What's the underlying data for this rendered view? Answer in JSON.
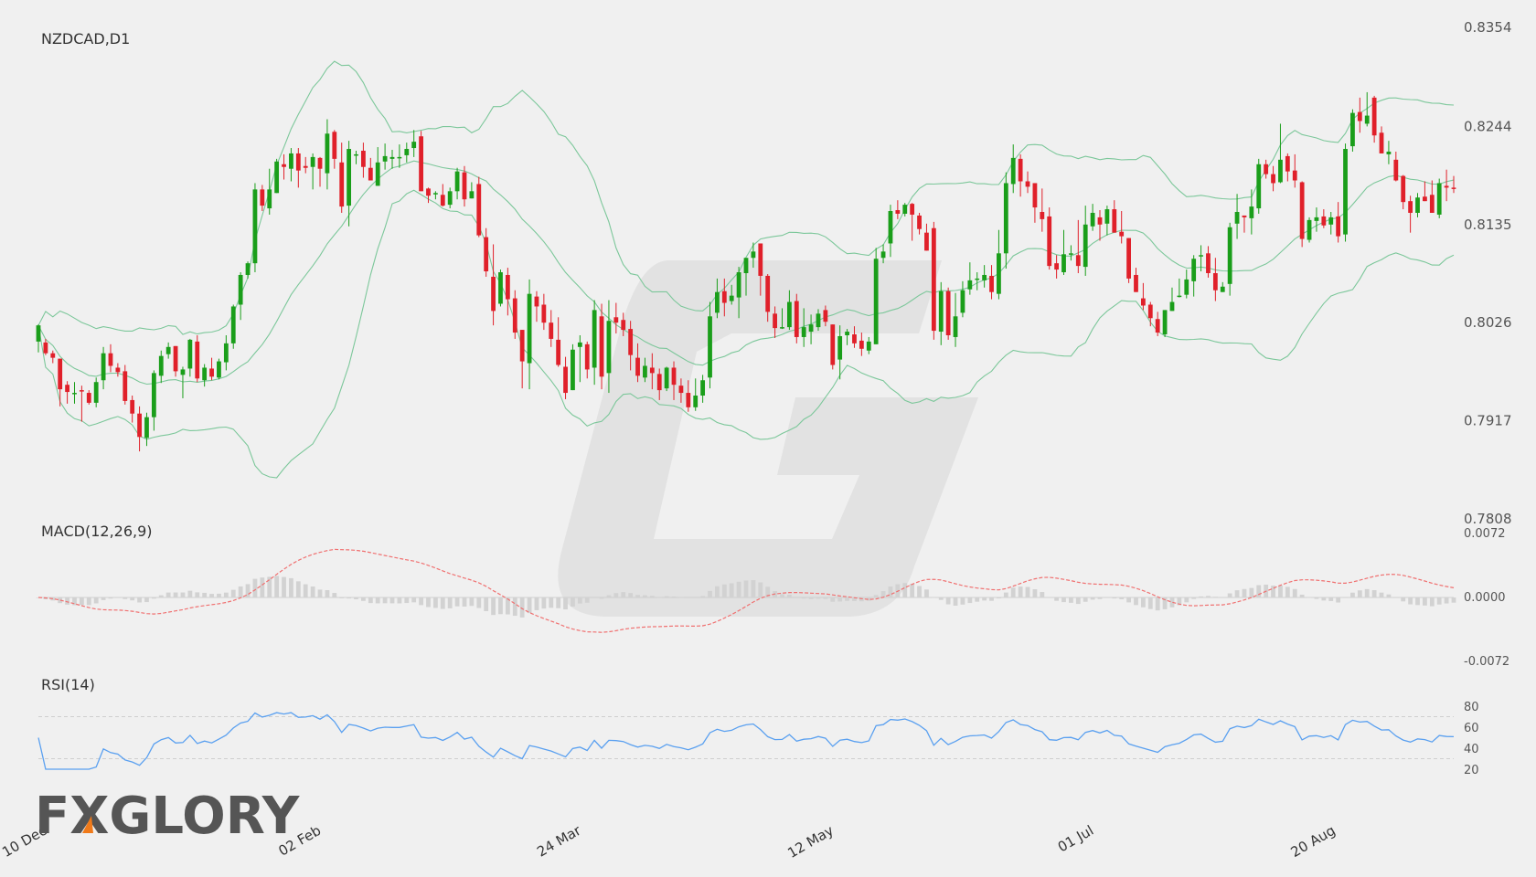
{
  "colors": {
    "background": "#f0f0f0",
    "bull": "#1a9e1a",
    "bear": "#e0202a",
    "bands": "#7cc79a",
    "macd_signal": "#f07070",
    "macd_hist": "#d2d2d2",
    "rsi": "#5aa0f0",
    "watermark": "#e2e2e2"
  },
  "logo": {
    "text": "FXGLORY"
  },
  "chart_data": {
    "type": "candlestick",
    "symbol_label": "NZDCAD,D1",
    "price_axis": {
      "ticks": [
        "0.8354",
        "0.8244",
        "0.8135",
        "0.8026",
        "0.7917",
        "0.7808"
      ],
      "ylim": [
        0.7808,
        0.8354
      ]
    },
    "x_ticks": [
      {
        "label": "10 Dec",
        "index": 0
      },
      {
        "label": "02 Feb",
        "index": 38
      },
      {
        "label": "24 Mar",
        "index": 74
      },
      {
        "label": "12 May",
        "index": 109
      },
      {
        "label": "01 Jul",
        "index": 145
      },
      {
        "label": "20 Aug",
        "index": 180
      }
    ],
    "bollinger": {
      "period": 20,
      "deviations": 2
    },
    "candles": [
      [
        0.8005,
        0.8023,
        0.7993,
        0.8024
      ],
      [
        0.8004,
        0.7992,
        0.799,
        0.8008
      ],
      [
        0.7992,
        0.7987,
        0.7981,
        0.7995
      ],
      [
        0.7986,
        0.7952,
        0.7933,
        0.7986
      ],
      [
        0.7957,
        0.7949,
        0.7936,
        0.7961
      ],
      [
        0.7948,
        0.7948,
        0.7936,
        0.796
      ],
      [
        0.7951,
        0.795,
        0.7916,
        0.7956
      ],
      [
        0.7948,
        0.7937,
        0.7935,
        0.7951
      ],
      [
        0.7937,
        0.796,
        0.7932,
        0.7965
      ],
      [
        0.7962,
        0.7992,
        0.7952,
        0.7999
      ],
      [
        0.7992,
        0.7978,
        0.7971,
        0.8002
      ],
      [
        0.7976,
        0.7971,
        0.7966,
        0.7981
      ],
      [
        0.7972,
        0.7939,
        0.7935,
        0.7979
      ],
      [
        0.794,
        0.7925,
        0.7915,
        0.7945
      ],
      [
        0.7925,
        0.7899,
        0.7883,
        0.7933
      ],
      [
        0.7898,
        0.7921,
        0.7889,
        0.7926
      ],
      [
        0.7921,
        0.797,
        0.7906,
        0.7973
      ],
      [
        0.7967,
        0.7989,
        0.7959,
        0.7995
      ],
      [
        0.7991,
        0.7999,
        0.7986,
        0.8004
      ],
      [
        0.8,
        0.7972,
        0.7966,
        0.8
      ],
      [
        0.7968,
        0.7974,
        0.7942,
        0.7977
      ],
      [
        0.7975,
        0.8007,
        0.7966,
        0.8008
      ],
      [
        0.8005,
        0.7964,
        0.796,
        0.8012
      ],
      [
        0.7962,
        0.7976,
        0.7955,
        0.798
      ],
      [
        0.7975,
        0.7966,
        0.7962,
        0.7987
      ],
      [
        0.7965,
        0.7983,
        0.7963,
        0.7986
      ],
      [
        0.7982,
        0.8003,
        0.7973,
        0.8012
      ],
      [
        0.8003,
        0.8044,
        0.7997,
        0.8046
      ],
      [
        0.8046,
        0.8079,
        0.8029,
        0.8082
      ],
      [
        0.8079,
        0.8092,
        0.8075,
        0.8094
      ],
      [
        0.8092,
        0.8174,
        0.8082,
        0.8181
      ],
      [
        0.8174,
        0.8156,
        0.815,
        0.8179
      ],
      [
        0.8153,
        0.8174,
        0.8146,
        0.8197
      ],
      [
        0.817,
        0.8205,
        0.817,
        0.8208
      ],
      [
        0.8202,
        0.8199,
        0.8185,
        0.8213
      ],
      [
        0.8197,
        0.8214,
        0.8183,
        0.822
      ],
      [
        0.8214,
        0.8195,
        0.8176,
        0.822
      ],
      [
        0.82,
        0.8198,
        0.8192,
        0.821
      ],
      [
        0.8199,
        0.821,
        0.8174,
        0.8214
      ],
      [
        0.8209,
        0.8197,
        0.8177,
        0.821
      ],
      [
        0.8192,
        0.8236,
        0.8174,
        0.8252
      ],
      [
        0.8238,
        0.8208,
        0.8197,
        0.824
      ],
      [
        0.8204,
        0.8155,
        0.8148,
        0.8226
      ],
      [
        0.8156,
        0.8219,
        0.8133,
        0.8228
      ],
      [
        0.8212,
        0.8213,
        0.8202,
        0.8217
      ],
      [
        0.8217,
        0.8199,
        0.8187,
        0.8226
      ],
      [
        0.8198,
        0.8184,
        0.8184,
        0.8209
      ],
      [
        0.8178,
        0.8204,
        0.8178,
        0.8221
      ],
      [
        0.8205,
        0.8211,
        0.8196,
        0.8225
      ],
      [
        0.8208,
        0.821,
        0.8197,
        0.8218
      ],
      [
        0.821,
        0.821,
        0.8198,
        0.8224
      ],
      [
        0.8212,
        0.8219,
        0.8204,
        0.8226
      ],
      [
        0.822,
        0.8227,
        0.821,
        0.824
      ],
      [
        0.8233,
        0.8172,
        0.8172,
        0.8239
      ],
      [
        0.8175,
        0.8167,
        0.8159,
        0.8176
      ],
      [
        0.817,
        0.817,
        0.8163,
        0.8172
      ],
      [
        0.8168,
        0.8156,
        0.8155,
        0.818
      ],
      [
        0.8157,
        0.8172,
        0.8153,
        0.8176
      ],
      [
        0.8172,
        0.8194,
        0.8163,
        0.8198
      ],
      [
        0.8193,
        0.8163,
        0.8155,
        0.82
      ],
      [
        0.8164,
        0.8172,
        0.8166,
        0.8182
      ],
      [
        0.818,
        0.8123,
        0.8121,
        0.8188
      ],
      [
        0.8121,
        0.8083,
        0.8077,
        0.8131
      ],
      [
        0.8077,
        0.8039,
        0.8023,
        0.8113
      ],
      [
        0.8047,
        0.8082,
        0.8044,
        0.8085
      ],
      [
        0.8079,
        0.8052,
        0.8034,
        0.8087
      ],
      [
        0.8053,
        0.8015,
        0.8008,
        0.8062
      ],
      [
        0.8018,
        0.7983,
        0.7953,
        0.8018
      ],
      [
        0.7981,
        0.8058,
        0.7952,
        0.8074
      ],
      [
        0.8055,
        0.8044,
        0.8027,
        0.8061
      ],
      [
        0.8046,
        0.8026,
        0.8018,
        0.8058
      ],
      [
        0.8026,
        0.8008,
        0.7999,
        0.804
      ],
      [
        0.8007,
        0.7979,
        0.7977,
        0.8032
      ],
      [
        0.7977,
        0.7948,
        0.7941,
        0.7988
      ],
      [
        0.7951,
        0.7996,
        0.7952,
        0.8002
      ],
      [
        0.7999,
        0.8004,
        0.796,
        0.8012
      ],
      [
        0.8002,
        0.7974,
        0.7964,
        0.8005
      ],
      [
        0.7976,
        0.804,
        0.7957,
        0.8051
      ],
      [
        0.8033,
        0.7966,
        0.7952,
        0.8047
      ],
      [
        0.797,
        0.8028,
        0.7948,
        0.8051
      ],
      [
        0.8032,
        0.8026,
        0.8014,
        0.8048
      ],
      [
        0.8029,
        0.8018,
        0.8011,
        0.8037
      ],
      [
        0.8019,
        0.799,
        0.7973,
        0.8028
      ],
      [
        0.7987,
        0.7967,
        0.796,
        0.8003
      ],
      [
        0.7965,
        0.7978,
        0.796,
        0.7987
      ],
      [
        0.7976,
        0.797,
        0.7952,
        0.7992
      ],
      [
        0.7969,
        0.7951,
        0.794,
        0.7975
      ],
      [
        0.7953,
        0.7976,
        0.795,
        0.7977
      ],
      [
        0.7976,
        0.7957,
        0.794,
        0.7983
      ],
      [
        0.7956,
        0.7948,
        0.7937,
        0.7964
      ],
      [
        0.7948,
        0.7932,
        0.7927,
        0.7962
      ],
      [
        0.7932,
        0.7945,
        0.7928,
        0.7964
      ],
      [
        0.7945,
        0.7962,
        0.7937,
        0.7968
      ],
      [
        0.7965,
        0.8033,
        0.7953,
        0.8049
      ],
      [
        0.8037,
        0.806,
        0.8031,
        0.8075
      ],
      [
        0.8061,
        0.8048,
        0.8033,
        0.8075
      ],
      [
        0.805,
        0.8056,
        0.8046,
        0.8068
      ],
      [
        0.8054,
        0.8082,
        0.8031,
        0.8088
      ],
      [
        0.8081,
        0.8098,
        0.8056,
        0.8096
      ],
      [
        0.8098,
        0.8105,
        0.8087,
        0.8115
      ],
      [
        0.8114,
        0.8078,
        0.8056,
        0.8102
      ],
      [
        0.8078,
        0.8038,
        0.8027,
        0.808
      ],
      [
        0.8036,
        0.802,
        0.8009,
        0.8044
      ],
      [
        0.802,
        0.8021,
        0.8019,
        0.8042
      ],
      [
        0.8021,
        0.8049,
        0.8018,
        0.8062
      ],
      [
        0.805,
        0.801,
        0.8003,
        0.8058
      ],
      [
        0.801,
        0.8021,
        0.7999,
        0.8042
      ],
      [
        0.8016,
        0.8024,
        0.8002,
        0.8035
      ],
      [
        0.8021,
        0.8036,
        0.8017,
        0.8041
      ],
      [
        0.804,
        0.8027,
        0.8022,
        0.8045
      ],
      [
        0.8024,
        0.7979,
        0.7974,
        0.8023
      ],
      [
        0.7985,
        0.8011,
        0.7963,
        0.8023
      ],
      [
        0.8012,
        0.8016,
        0.8001,
        0.8019
      ],
      [
        0.8013,
        0.8003,
        0.7998,
        0.8022
      ],
      [
        0.8006,
        0.7997,
        0.7989,
        0.8015
      ],
      [
        0.7995,
        0.8005,
        0.7991,
        0.801
      ],
      [
        0.8002,
        0.8097,
        0.8002,
        0.8109
      ],
      [
        0.8098,
        0.8105,
        0.8092,
        0.8113
      ],
      [
        0.8114,
        0.815,
        0.8099,
        0.8157
      ],
      [
        0.8151,
        0.8147,
        0.8141,
        0.8162
      ],
      [
        0.8147,
        0.8157,
        0.8144,
        0.8159
      ],
      [
        0.8158,
        0.8146,
        0.8117,
        0.8159
      ],
      [
        0.8145,
        0.813,
        0.8124,
        0.8148
      ],
      [
        0.8126,
        0.8106,
        0.8106,
        0.8136
      ],
      [
        0.8131,
        0.8017,
        0.8007,
        0.8138
      ],
      [
        0.8016,
        0.8061,
        0.8001,
        0.8071
      ],
      [
        0.8061,
        0.8012,
        0.8007,
        0.8065
      ],
      [
        0.801,
        0.8033,
        0.7999,
        0.8059
      ],
      [
        0.8037,
        0.8062,
        0.8032,
        0.8072
      ],
      [
        0.8063,
        0.8073,
        0.8057,
        0.8093
      ],
      [
        0.8075,
        0.8075,
        0.8062,
        0.8082
      ],
      [
        0.8073,
        0.8079,
        0.8065,
        0.809
      ],
      [
        0.8078,
        0.806,
        0.8052,
        0.809
      ],
      [
        0.8058,
        0.8103,
        0.8052,
        0.8129
      ],
      [
        0.8103,
        0.8181,
        0.8086,
        0.8193
      ],
      [
        0.818,
        0.8209,
        0.817,
        0.8224
      ],
      [
        0.8208,
        0.8183,
        0.8166,
        0.8213
      ],
      [
        0.8183,
        0.8177,
        0.817,
        0.8194
      ],
      [
        0.8181,
        0.8154,
        0.8137,
        0.818
      ],
      [
        0.8149,
        0.8141,
        0.8127,
        0.8175
      ],
      [
        0.8144,
        0.8089,
        0.8085,
        0.8154
      ],
      [
        0.8092,
        0.8085,
        0.8075,
        0.8101
      ],
      [
        0.8082,
        0.8102,
        0.8079,
        0.8129
      ],
      [
        0.8102,
        0.8103,
        0.8095,
        0.8112
      ],
      [
        0.8101,
        0.8089,
        0.8081,
        0.814
      ],
      [
        0.8088,
        0.8135,
        0.8078,
        0.8156
      ],
      [
        0.8133,
        0.8148,
        0.8128,
        0.8158
      ],
      [
        0.8143,
        0.8135,
        0.8117,
        0.8151
      ],
      [
        0.8136,
        0.8152,
        0.8123,
        0.8156
      ],
      [
        0.8152,
        0.8126,
        0.813,
        0.8162
      ],
      [
        0.8127,
        0.8122,
        0.8114,
        0.815
      ],
      [
        0.812,
        0.8075,
        0.807,
        0.8116
      ],
      [
        0.8079,
        0.806,
        0.8061,
        0.8087
      ],
      [
        0.8053,
        0.8045,
        0.804,
        0.807
      ],
      [
        0.8046,
        0.8031,
        0.8022,
        0.8049
      ],
      [
        0.803,
        0.8015,
        0.8011,
        0.8038
      ],
      [
        0.8013,
        0.804,
        0.801,
        0.8038
      ],
      [
        0.8039,
        0.8049,
        0.8041,
        0.8065
      ],
      [
        0.8055,
        0.8056,
        0.8054,
        0.8075
      ],
      [
        0.8057,
        0.8074,
        0.8053,
        0.8085
      ],
      [
        0.8072,
        0.8097,
        0.8055,
        0.8101
      ],
      [
        0.81,
        0.8101,
        0.8083,
        0.8112
      ],
      [
        0.8103,
        0.8081,
        0.8076,
        0.8111
      ],
      [
        0.8081,
        0.8062,
        0.805,
        0.8098
      ],
      [
        0.806,
        0.8066,
        0.8064,
        0.8071
      ],
      [
        0.8069,
        0.8132,
        0.8056,
        0.8137
      ],
      [
        0.8136,
        0.8149,
        0.8119,
        0.8169
      ],
      [
        0.8145,
        0.8143,
        0.8126,
        0.8145
      ],
      [
        0.8142,
        0.8155,
        0.8124,
        0.8174
      ],
      [
        0.8153,
        0.8202,
        0.8147,
        0.8208
      ],
      [
        0.8202,
        0.8191,
        0.8186,
        0.8207
      ],
      [
        0.8191,
        0.8181,
        0.8172,
        0.82
      ],
      [
        0.8182,
        0.8207,
        0.8181,
        0.8247
      ],
      [
        0.8211,
        0.8194,
        0.8183,
        0.8214
      ],
      [
        0.8195,
        0.8184,
        0.8176,
        0.8213
      ],
      [
        0.8182,
        0.8119,
        0.811,
        0.8183
      ],
      [
        0.8118,
        0.814,
        0.8115,
        0.8143
      ],
      [
        0.8139,
        0.8143,
        0.8127,
        0.8154
      ],
      [
        0.8144,
        0.8134,
        0.8131,
        0.8152
      ],
      [
        0.8135,
        0.8143,
        0.8124,
        0.8149
      ],
      [
        0.8144,
        0.8122,
        0.8115,
        0.816
      ],
      [
        0.8124,
        0.8219,
        0.8116,
        0.8225
      ],
      [
        0.8222,
        0.8259,
        0.8216,
        0.8263
      ],
      [
        0.826,
        0.825,
        0.8237,
        0.8276
      ],
      [
        0.8247,
        0.8256,
        0.8244,
        0.8282
      ],
      [
        0.8276,
        0.8234,
        0.8226,
        0.8278
      ],
      [
        0.8237,
        0.8214,
        0.8216,
        0.8244
      ],
      [
        0.8213,
        0.8216,
        0.8202,
        0.8228
      ],
      [
        0.8207,
        0.8184,
        0.8183,
        0.8216
      ],
      [
        0.8189,
        0.816,
        0.8152,
        0.819
      ],
      [
        0.8161,
        0.8148,
        0.8126,
        0.8167
      ],
      [
        0.8148,
        0.8165,
        0.8143,
        0.817
      ],
      [
        0.8166,
        0.8161,
        0.8162,
        0.8183
      ],
      [
        0.8168,
        0.8148,
        0.8154,
        0.8184
      ],
      [
        0.8146,
        0.8181,
        0.8142,
        0.8186
      ],
      [
        0.8178,
        0.8176,
        0.8161,
        0.8196
      ],
      [
        0.8176,
        0.8175,
        0.817,
        0.8189
      ]
    ],
    "macd": {
      "label": "MACD(12,26,9)",
      "ylim": [
        -0.0072,
        0.0072
      ],
      "ticks": [
        "0.0072",
        "0.0000",
        "-0.0072"
      ]
    },
    "rsi": {
      "label": "RSI(14)",
      "period": 14,
      "ylim": [
        20,
        80
      ],
      "ticks": [
        "80",
        "60",
        "40",
        "20"
      ],
      "levels": [
        70,
        30
      ]
    }
  }
}
